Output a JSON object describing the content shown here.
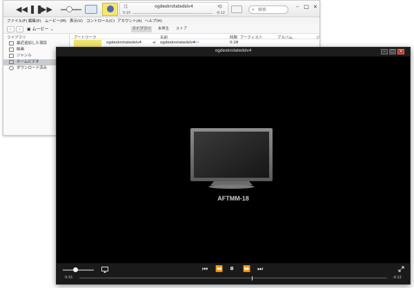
{
  "itunes": {
    "transport": {
      "prev": "◀◀",
      "play": "❚❚",
      "next": "▶▶"
    },
    "now_playing": {
      "title": "ogdeskrotatedslv4",
      "elapsed": "0:15",
      "remaining": "-0:12"
    },
    "search_placeholder": "検索",
    "menu": [
      "ファイル(F)",
      "編集(E)",
      "ムービー(M)",
      "表示(V)",
      "コントロール(C)",
      "アカウント(A)",
      "ヘルプ(H)"
    ],
    "media_selector": "ムービー",
    "tabs": [
      "ライブラリ",
      "未再生",
      "ストア"
    ],
    "sidebar": {
      "heading": "ライブラリ",
      "items": [
        "最近追加した項目",
        "映画",
        "ジャンル",
        "ホームビデオ",
        "ダウンロード済み"
      ]
    },
    "columns": [
      "アートワーク",
      "名前",
      "時間",
      "アーティスト",
      "アルバム",
      "ジ"
    ],
    "row": {
      "artwork_title": "ogdeskrotatedslv4",
      "name": "ogdeskrotatedslv4",
      "time": "0:28"
    }
  },
  "player": {
    "title": "ogdeskrotatedslv4",
    "device_name": "AFTMM-18",
    "elapsed": "0:15",
    "remaining": "-0:12",
    "progress_fraction": 0.56,
    "volume_fraction": 0.4,
    "colors": {
      "background": "#000000",
      "control_bar": "#1a1a1a",
      "close": "#c0392b"
    }
  }
}
